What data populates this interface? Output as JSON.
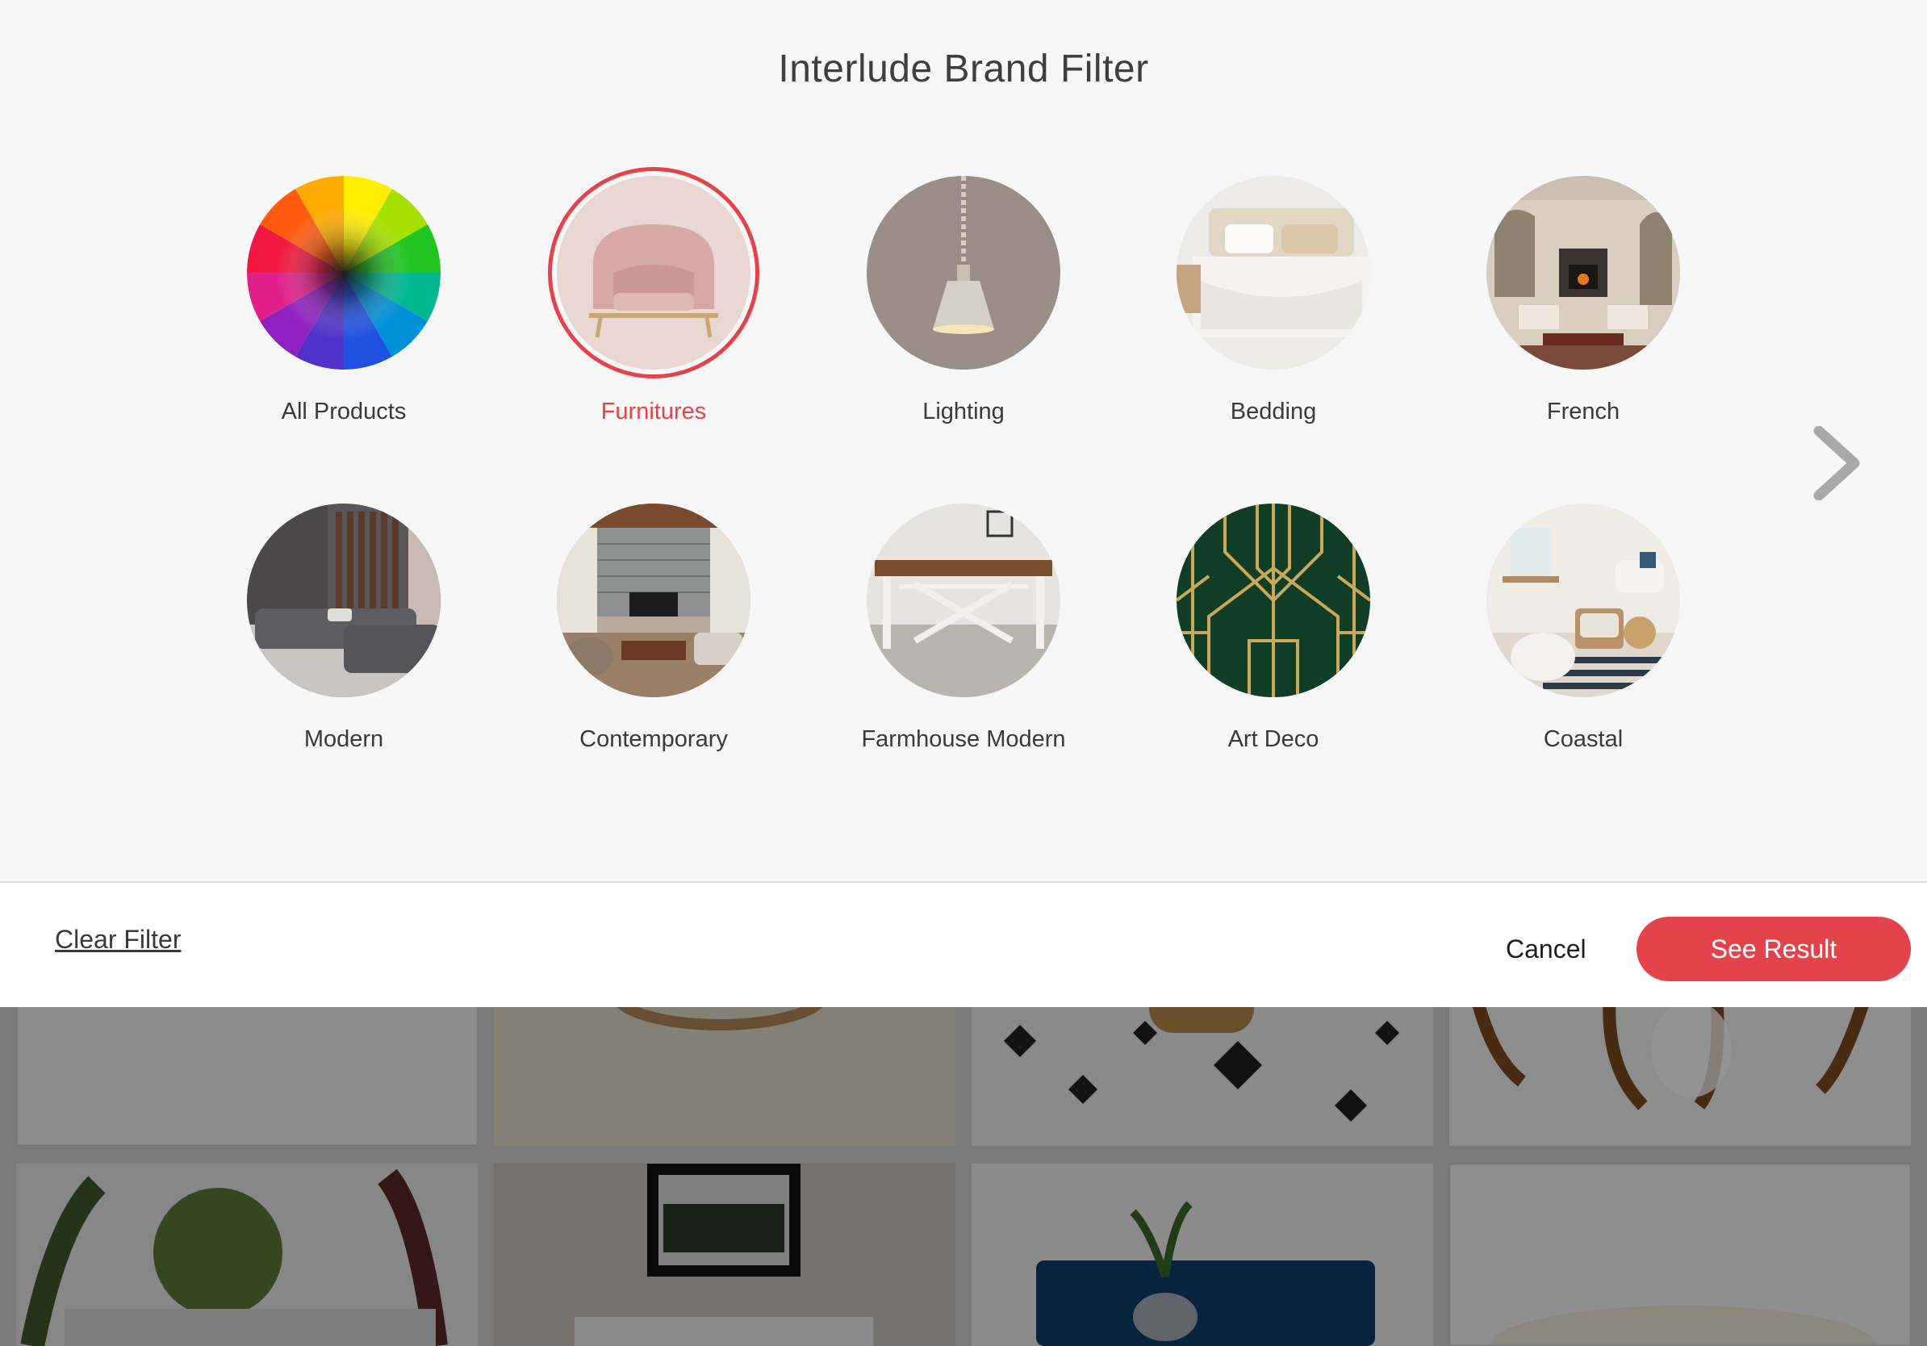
{
  "title": "Interlude Brand Filter",
  "categories": [
    {
      "label": "All Products",
      "image": "color-wheel",
      "selected": false
    },
    {
      "label": "Furnitures",
      "image": "pink-armchair",
      "selected": true
    },
    {
      "label": "Lighting",
      "image": "pendant-lamp",
      "selected": false
    },
    {
      "label": "Bedding",
      "image": "bed-linens",
      "selected": false
    },
    {
      "label": "French",
      "image": "french-living-room",
      "selected": false
    },
    {
      "label": "Modern",
      "image": "modern-sofa-room",
      "selected": false
    },
    {
      "label": "Contemporary",
      "image": "stone-fireplace-room",
      "selected": false
    },
    {
      "label": "Farmhouse Modern",
      "image": "farmhouse-table",
      "selected": false
    },
    {
      "label": "Art Deco",
      "image": "art-deco-pattern",
      "selected": false
    },
    {
      "label": "Coastal",
      "image": "coastal-living-room",
      "selected": false
    }
  ],
  "next_icon": "chevron-right-icon",
  "actions": {
    "clear_label": "Clear Filter",
    "cancel_label": "Cancel",
    "see_result_label": "See Result"
  },
  "colors": {
    "accent": "#e5434c",
    "panel_bg": "#f7f7f7",
    "text": "#3a3a3a"
  }
}
